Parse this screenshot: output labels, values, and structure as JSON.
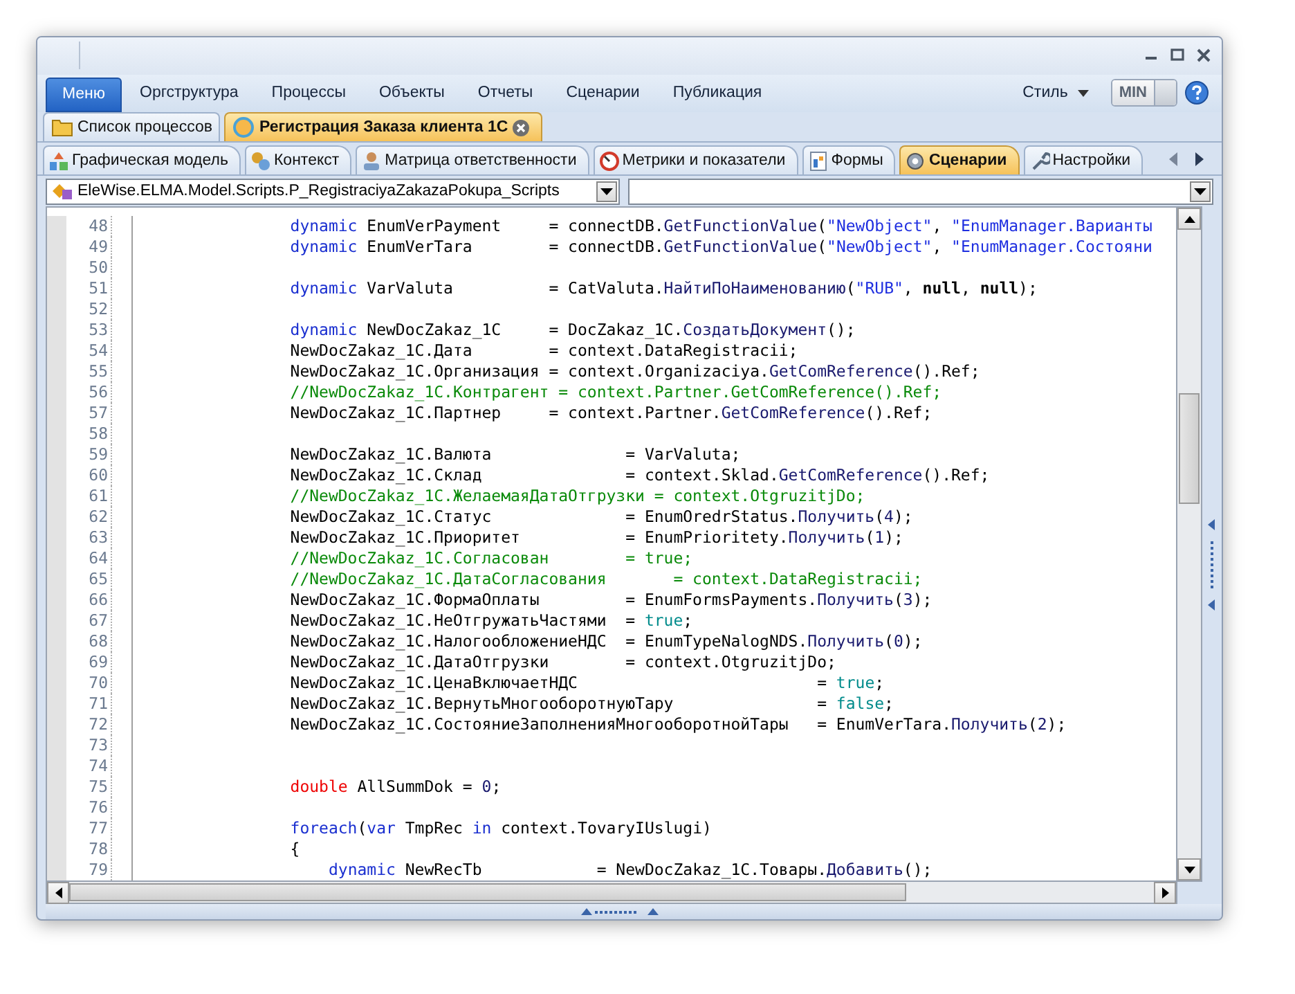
{
  "menu": {
    "app_button": "Меню",
    "items": [
      "Оргструктура",
      "Процессы",
      "Объекты",
      "Отчеты",
      "Сценарии",
      "Публикация"
    ],
    "style_menu": "Стиль",
    "min_button": "MIN"
  },
  "document_tabs": [
    {
      "label": "Список процессов",
      "selected": false
    },
    {
      "label": "Регистрация Заказа клиента 1С",
      "selected": true
    }
  ],
  "designer_tabs": [
    {
      "label": "Графическая модель",
      "selected": false
    },
    {
      "label": "Контекст",
      "selected": false
    },
    {
      "label": "Матрица ответственности",
      "selected": false
    },
    {
      "label": "Метрики и показатели",
      "selected": false
    },
    {
      "label": "Формы",
      "selected": false
    },
    {
      "label": "Сценарии",
      "selected": true
    },
    {
      "label": "Настройки",
      "selected": false
    }
  ],
  "class_selector": {
    "value": "EleWise.ELMA.Model.Scripts.P_RegistraciyaZakazaPokupa_Scripts"
  },
  "editor": {
    "lines": [
      {
        "number": "48",
        "kind": "body",
        "tokens": [
          {
            "kind": "kw",
            "text": "dynamic"
          },
          {
            "kind": "txt",
            "text": " EnumVerPayment     = connectDB."
          },
          {
            "kind": "fn",
            "text": "GetFunctionValue"
          },
          {
            "kind": "txt",
            "text": "("
          },
          {
            "kind": "str",
            "text": "\"NewObject\""
          },
          {
            "kind": "txt",
            "text": ", "
          },
          {
            "kind": "str",
            "text": "\"EnumManager.Варианты"
          }
        ]
      },
      {
        "number": "49",
        "kind": "body",
        "tokens": [
          {
            "kind": "kw",
            "text": "dynamic"
          },
          {
            "kind": "txt",
            "text": " EnumVerTara        = connectDB."
          },
          {
            "kind": "fn",
            "text": "GetFunctionValue"
          },
          {
            "kind": "txt",
            "text": "("
          },
          {
            "kind": "str",
            "text": "\"NewObject\""
          },
          {
            "kind": "txt",
            "text": ", "
          },
          {
            "kind": "str",
            "text": "\"EnumManager.Состояни"
          }
        ]
      },
      {
        "number": "50"
      },
      {
        "number": "51",
        "kind": "body",
        "tokens": [
          {
            "kind": "kw",
            "text": "dynamic"
          },
          {
            "kind": "txt",
            "text": " VarValuta          = CatValuta."
          },
          {
            "kind": "fn",
            "text": "НайтиПоНаименованию"
          },
          {
            "kind": "txt",
            "text": "("
          },
          {
            "kind": "str",
            "text": "\"RUB\""
          },
          {
            "kind": "txt",
            "text": ", "
          },
          {
            "kind": "null",
            "text": "null"
          },
          {
            "kind": "txt",
            "text": ", "
          },
          {
            "kind": "null",
            "text": "null"
          },
          {
            "kind": "txt",
            "text": ");"
          }
        ]
      },
      {
        "number": "52"
      },
      {
        "number": "53",
        "kind": "body",
        "tokens": [
          {
            "kind": "kw",
            "text": "dynamic"
          },
          {
            "kind": "txt",
            "text": " NewDocZakaz_1C     = DocZakaz_1C."
          },
          {
            "kind": "fn",
            "text": "СоздатьДокумент"
          },
          {
            "kind": "txt",
            "text": "();"
          }
        ]
      },
      {
        "number": "54",
        "kind": "body",
        "tokens": [
          {
            "kind": "txt",
            "text": "NewDocZakaz_1C.Дата        = context.DataRegistracii;"
          }
        ]
      },
      {
        "number": "55",
        "kind": "body",
        "tokens": [
          {
            "kind": "txt",
            "text": "NewDocZakaz_1C.Организация = context.Organizaciya."
          },
          {
            "kind": "fn",
            "text": "GetComReference"
          },
          {
            "kind": "txt",
            "text": "().Ref;"
          }
        ]
      },
      {
        "number": "56",
        "kind": "body",
        "tokens": [
          {
            "kind": "cmt",
            "text": "//NewDocZakaz_1C.Контрагент = context.Partner.GetComReference().Ref;"
          }
        ]
      },
      {
        "number": "57",
        "kind": "body",
        "tokens": [
          {
            "kind": "txt",
            "text": "NewDocZakaz_1C.Партнер     = context.Partner."
          },
          {
            "kind": "fn",
            "text": "GetComReference"
          },
          {
            "kind": "txt",
            "text": "().Ref;"
          }
        ]
      },
      {
        "number": "58"
      },
      {
        "number": "59",
        "kind": "body",
        "tokens": [
          {
            "kind": "txt",
            "text": "NewDocZakaz_1C.Валюта              = VarValuta;"
          }
        ]
      },
      {
        "number": "60",
        "kind": "body",
        "tokens": [
          {
            "kind": "txt",
            "text": "NewDocZakaz_1C.Склад               = context.Sklad."
          },
          {
            "kind": "fn",
            "text": "GetComReference"
          },
          {
            "kind": "txt",
            "text": "().Ref;"
          }
        ]
      },
      {
        "number": "61",
        "kind": "body",
        "tokens": [
          {
            "kind": "cmt",
            "text": "//NewDocZakaz_1C.ЖелаемаяДатаОтгрузки = context.OtgruzitjDo;"
          }
        ]
      },
      {
        "number": "62",
        "kind": "body",
        "tokens": [
          {
            "kind": "txt",
            "text": "NewDocZakaz_1C.Статус              = EnumOredrStatus."
          },
          {
            "kind": "fn",
            "text": "Получить"
          },
          {
            "kind": "txt",
            "text": "("
          },
          {
            "kind": "num",
            "text": "4"
          },
          {
            "kind": "txt",
            "text": ");"
          }
        ]
      },
      {
        "number": "63",
        "kind": "body",
        "tokens": [
          {
            "kind": "txt",
            "text": "NewDocZakaz_1C.Приоритет           = EnumPrioritety."
          },
          {
            "kind": "fn",
            "text": "Получить"
          },
          {
            "kind": "txt",
            "text": "("
          },
          {
            "kind": "num",
            "text": "1"
          },
          {
            "kind": "txt",
            "text": ");"
          }
        ]
      },
      {
        "number": "64",
        "kind": "body",
        "tokens": [
          {
            "kind": "cmt",
            "text": "//NewDocZakaz_1C.Согласован        = true;"
          }
        ]
      },
      {
        "number": "65",
        "kind": "body",
        "tokens": [
          {
            "kind": "cmt",
            "text": "//NewDocZakaz_1C.ДатаСогласования       = context.DataRegistracii;"
          }
        ]
      },
      {
        "number": "66",
        "kind": "body",
        "tokens": [
          {
            "kind": "txt",
            "text": "NewDocZakaz_1C.ФормаОплаты         = EnumFormsPayments."
          },
          {
            "kind": "fn",
            "text": "Получить"
          },
          {
            "kind": "txt",
            "text": "("
          },
          {
            "kind": "num",
            "text": "3"
          },
          {
            "kind": "txt",
            "text": ");"
          }
        ]
      },
      {
        "number": "67",
        "kind": "body",
        "tokens": [
          {
            "kind": "txt",
            "text": "NewDocZakaz_1C.НеОтгружатьЧастями  = "
          },
          {
            "kind": "lit",
            "text": "true"
          },
          {
            "kind": "txt",
            "text": ";"
          }
        ]
      },
      {
        "number": "68",
        "kind": "body",
        "tokens": [
          {
            "kind": "txt",
            "text": "NewDocZakaz_1C.НалогообложениеНДС  = EnumTypeNalogNDS."
          },
          {
            "kind": "fn",
            "text": "Получить"
          },
          {
            "kind": "txt",
            "text": "("
          },
          {
            "kind": "num",
            "text": "0"
          },
          {
            "kind": "txt",
            "text": ");"
          }
        ]
      },
      {
        "number": "69",
        "kind": "body",
        "tokens": [
          {
            "kind": "txt",
            "text": "NewDocZakaz_1C.ДатаОтгрузки        = context.OtgruzitjDo;"
          }
        ]
      },
      {
        "number": "70",
        "kind": "body",
        "tokens": [
          {
            "kind": "txt",
            "text": "NewDocZakaz_1C.ЦенаВключаетНДС                         = "
          },
          {
            "kind": "lit",
            "text": "true"
          },
          {
            "kind": "txt",
            "text": ";"
          }
        ]
      },
      {
        "number": "71",
        "kind": "body",
        "tokens": [
          {
            "kind": "txt",
            "text": "NewDocZakaz_1C.ВернутьМногооборотнуюТару               = "
          },
          {
            "kind": "lit",
            "text": "false"
          },
          {
            "kind": "txt",
            "text": ";"
          }
        ]
      },
      {
        "number": "72",
        "kind": "body",
        "tokens": [
          {
            "kind": "txt",
            "text": "NewDocZakaz_1C.СостояниеЗаполненияМногооборотнойТары   = EnumVerTara."
          },
          {
            "kind": "fn",
            "text": "Получить"
          },
          {
            "kind": "txt",
            "text": "("
          },
          {
            "kind": "num",
            "text": "2"
          },
          {
            "kind": "txt",
            "text": ");"
          }
        ]
      },
      {
        "number": "73"
      },
      {
        "number": "74"
      },
      {
        "number": "75",
        "kind": "body",
        "tokens": [
          {
            "kind": "type",
            "text": "double"
          },
          {
            "kind": "txt",
            "text": " AllSummDok = "
          },
          {
            "kind": "num",
            "text": "0"
          },
          {
            "kind": "txt",
            "text": ";"
          }
        ]
      },
      {
        "number": "76"
      },
      {
        "number": "77",
        "kind": "body",
        "tokens": [
          {
            "kind": "kw",
            "text": "foreach"
          },
          {
            "kind": "txt",
            "text": "("
          },
          {
            "kind": "kw",
            "text": "var"
          },
          {
            "kind": "txt",
            "text": " TmpRec "
          },
          {
            "kind": "kw",
            "text": "in"
          },
          {
            "kind": "txt",
            "text": " context.TovaryIUslugi)"
          }
        ]
      },
      {
        "number": "78",
        "kind": "body",
        "tokens": [
          {
            "kind": "txt",
            "text": "{"
          }
        ]
      },
      {
        "number": "79",
        "kind": "nested",
        "tokens": [
          {
            "kind": "kw",
            "text": "dynamic"
          },
          {
            "kind": "txt",
            "text": " NewRecTb            = NewDocZakaz_1C.Товары."
          },
          {
            "kind": "fn",
            "text": "Добавить"
          },
          {
            "kind": "txt",
            "text": "();"
          }
        ]
      }
    ]
  }
}
